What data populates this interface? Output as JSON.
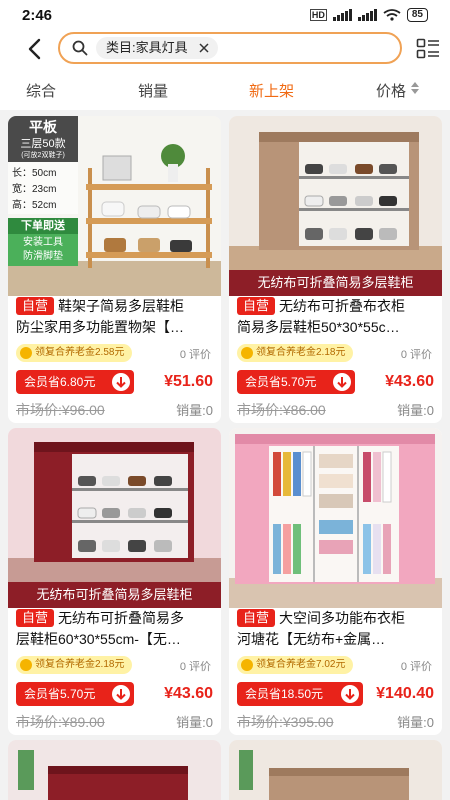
{
  "status_bar": {
    "time": "2:46",
    "network": "HD",
    "battery": "85"
  },
  "search": {
    "chip_label": "类目:家具灯具"
  },
  "sort_tabs": [
    {
      "label": "综合"
    },
    {
      "label": "销量"
    },
    {
      "label": "新上架",
      "active": true
    },
    {
      "label": "价格"
    }
  ],
  "colors": {
    "accent": "#f06a13",
    "price_red": "#e8231a",
    "search_border": "#f0a255",
    "coupon_bg": "#fff2a5"
  },
  "products": [
    {
      "overlay": {
        "header": "平板",
        "sub": "三层50款",
        "note": "(可放2双鞋子)",
        "dims": [
          "长：50cm",
          "宽：23cm",
          "高：52cm"
        ],
        "promo_title": "下单即送",
        "promo_items": [
          "安装工具",
          "防滑脚垫"
        ]
      },
      "tag": "自营",
      "title_line1": "鞋架子简易多层鞋柜",
      "title_line2": "防尘家用多功能置物架【…",
      "coupon": "领复合养老金2.58元",
      "reviews": "0 评价",
      "member": "会员省6.80元",
      "price": "¥51.60",
      "market": "市场价:¥96.00",
      "sales": "销量:0"
    },
    {
      "caption": "无纺布可折叠简易多层鞋柜",
      "tag": "自营",
      "title_line1": "无纺布可折叠布衣柜",
      "title_line2": "简易多层鞋柜50*30*55c…",
      "coupon": "领复合养老金2.18元",
      "reviews": "0 评价",
      "member": "会员省5.70元",
      "price": "¥43.60",
      "market": "市场价:¥86.00",
      "sales": "销量:0"
    },
    {
      "caption": "无纺布可折叠简易多层鞋柜",
      "tag": "自营",
      "title_line1": "无纺布可折叠简易多",
      "title_line2": "层鞋柜60*30*55cm-【无…",
      "coupon": "领复合养老金2.18元",
      "reviews": "0 评价",
      "member": "会员省5.70元",
      "price": "¥43.60",
      "market": "市场价:¥89.00",
      "sales": "销量:0"
    },
    {
      "tag": "自营",
      "title_line1": "大空间多功能布衣柜",
      "title_line2": "河塘花【无纺布+金属…",
      "coupon": "领复合养老金7.02元",
      "reviews": "0 评价",
      "member": "会员省18.50元",
      "price": "¥140.40",
      "market": "市场价:¥395.00",
      "sales": "销量:0"
    }
  ],
  "icons": [
    "back-arrow-icon",
    "search-icon",
    "close-icon",
    "list-layout-icon",
    "sort-arrows-icon",
    "coin-icon",
    "down-arrow-icon"
  ]
}
